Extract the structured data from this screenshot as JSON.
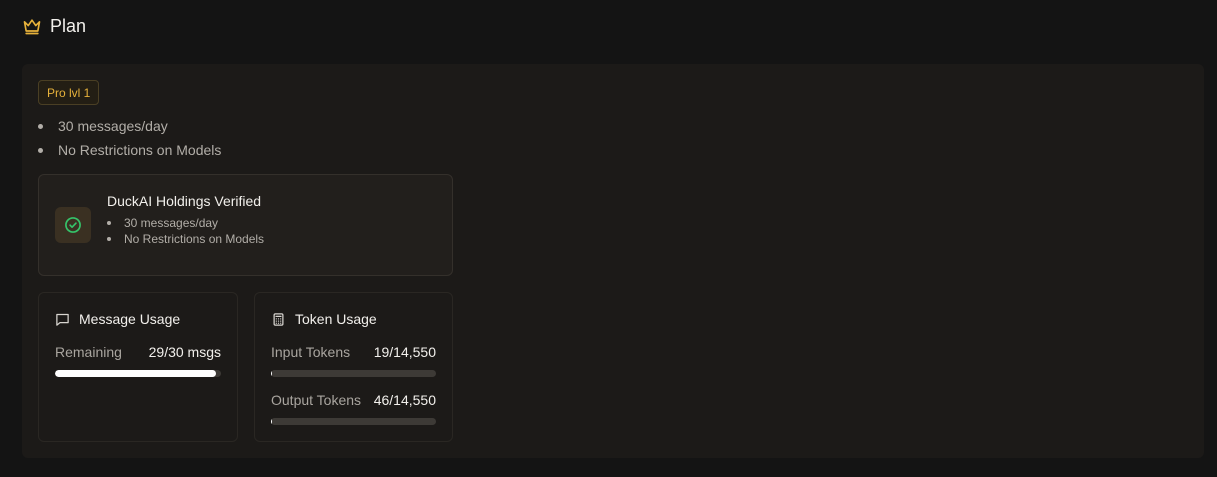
{
  "header": {
    "title": "Plan",
    "icon": "crown-icon"
  },
  "plan": {
    "badge": "Pro lvl 1",
    "features": [
      "30 messages/day",
      "No Restrictions on Models"
    ]
  },
  "verified": {
    "title": "DuckAI Holdings Verified",
    "icon": "check-circle-icon",
    "features": [
      "30 messages/day",
      "No Restrictions on Models"
    ]
  },
  "message_usage": {
    "title": "Message Usage",
    "icon": "chat-bubble-icon",
    "remaining_label": "Remaining",
    "remaining_value": "29/30 msgs",
    "progress": 0.967
  },
  "token_usage": {
    "title": "Token Usage",
    "icon": "calculator-icon",
    "input_label": "Input Tokens",
    "input_value": "19/14,550",
    "input_progress": 0.0013,
    "output_label": "Output Tokens",
    "output_value": "46/14,550",
    "output_progress": 0.0032
  },
  "colors": {
    "accent": "#e7b23b",
    "success": "#35c46a",
    "background": "#141414",
    "panel": "#1c1a18"
  }
}
